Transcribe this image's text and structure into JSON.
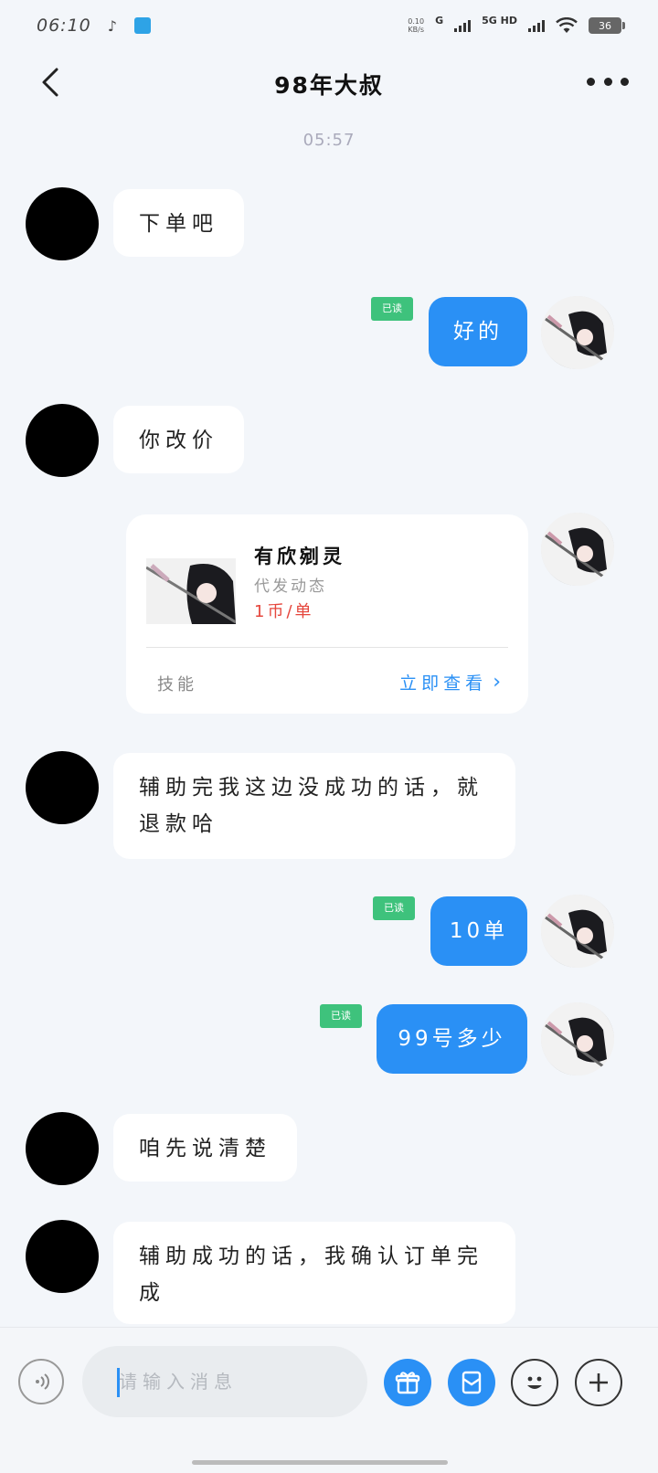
{
  "status_bar": {
    "time": "06:10",
    "net_speed_value": "0.10",
    "net_speed_unit": "KB/s",
    "net_type_1": "G",
    "net_type_2": "5G HD",
    "battery": "36"
  },
  "header": {
    "title": "98年大叔"
  },
  "conversation": {
    "timestamp": "05:57",
    "messages": [
      {
        "side": "in",
        "text": "下单吧"
      },
      {
        "side": "out",
        "text": "好的",
        "read": "已读"
      },
      {
        "side": "in",
        "text": "你改价"
      },
      {
        "side": "out",
        "type": "card",
        "card": {
          "name": "有欣剜灵",
          "subtitle": "代发动态",
          "price": "1币/单",
          "tag": "技能",
          "link": "立即查看"
        }
      },
      {
        "side": "in",
        "text_line1": "辅助完我这边没成功的话，就",
        "text_line2": "退款哈"
      },
      {
        "side": "out",
        "text": "10单",
        "read": "已读"
      },
      {
        "side": "out",
        "text": "99号多少",
        "read": "已读"
      },
      {
        "side": "in",
        "text": "咱先说清楚"
      },
      {
        "side": "in",
        "text_line1": "辅助成功的话，我确认订单完",
        "text_line2": "成"
      }
    ]
  },
  "input_bar": {
    "placeholder": "请输入消息"
  },
  "colors": {
    "accent": "#2a90f5",
    "read_badge": "#3ec27c",
    "price": "#e5463c",
    "background": "#f3f6fa"
  },
  "icons": {
    "back": "chevron-left-icon",
    "more": "more-dots-icon",
    "voice": "voice-icon",
    "gift": "gift-icon",
    "red_packet": "red-packet-icon",
    "emoji": "emoji-icon",
    "add": "plus-icon"
  }
}
